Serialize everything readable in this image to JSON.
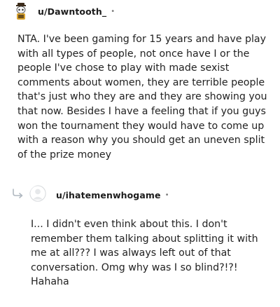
{
  "comments": [
    {
      "username": "u/Dawntooth_",
      "separator": "•",
      "text": "NTA. I've been gaming for 15 years and have play with all types of people, not once have I or the people I've chose to play with made sexist comments about women, they are terrible people that's just who they are and they are showing you that now. Besides I have a feeling that if you guys won the tournament they would have to come up with a reason why you should get an uneven split of the prize money"
    },
    {
      "username": "u/ihatemenwhogame",
      "separator": "•",
      "text": "I... I didn't even think about this. I don't remember them talking about splitting it with me at all??? I was always left out of that conversation. Omg why was I so blind?!?! Hahaha"
    }
  ],
  "icons": {
    "avatar1": "snoo-avatar-icon",
    "avatar2": "default-avatar-icon",
    "reply": "reply-arrow-icon"
  },
  "colors": {
    "text": "#1c1c1c",
    "meta": "#7c7c7c",
    "reply_arrow": "#b0b8c0"
  }
}
